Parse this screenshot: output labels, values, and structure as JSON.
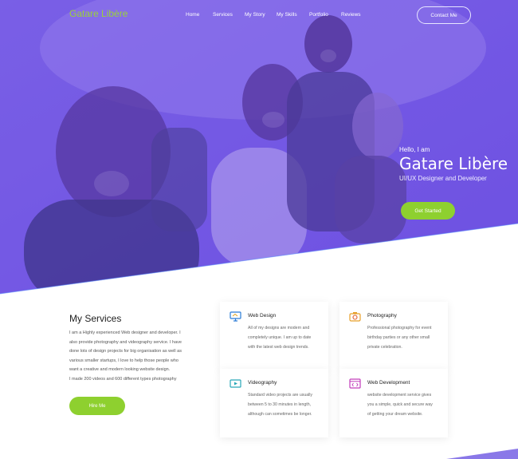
{
  "nav": {
    "brand": "Gatare Libère",
    "items": [
      "Home",
      "Services",
      "My Story",
      "My Skills",
      "Portfolio",
      "Reviews"
    ],
    "contact_label": "Contact Me"
  },
  "hero": {
    "greeting": "Hello, I am",
    "name": "Gatare Libère",
    "role": "UI/UX Designer and Developer",
    "cta_label": "Get Started"
  },
  "services": {
    "title": "My Services",
    "about_lines": [
      "I am a Highly experienced Web designer and developer. I",
      "also provide photography and videography service. I have",
      "done lots of design projects for big organisation as well as",
      "various smaller startups, I love to help those people who",
      "want a creative and modern looking website design.",
      "I made 200 videos  and 600 different types photography"
    ],
    "hire_label": "Hire Me",
    "cards": [
      {
        "icon": "monitor-icon",
        "title": "Web Design",
        "lines": [
          "All of my designs are modern and",
          "completely unique. I am up to date",
          "with the latest web design trends."
        ]
      },
      {
        "icon": "camera-icon",
        "title": "Photography",
        "lines": [
          "Professional photography for event",
          "birthday parties or any other small",
          "private celebration."
        ]
      },
      {
        "icon": "video-icon",
        "title": "Videography",
        "lines": [
          "Standard video projects are usually",
          "between 5 to 30 minutes in length,",
          "although can sometimes be longer."
        ]
      },
      {
        "icon": "code-window-icon",
        "title": "Web Development",
        "lines": [
          "website development service gives",
          "you a simple, quick and secure way",
          "of getting your dream website."
        ]
      }
    ]
  },
  "colors": {
    "accent_green": "#8ed02f",
    "brand_green": "#9bd13a",
    "hero_purple": "#7a5ee8"
  }
}
